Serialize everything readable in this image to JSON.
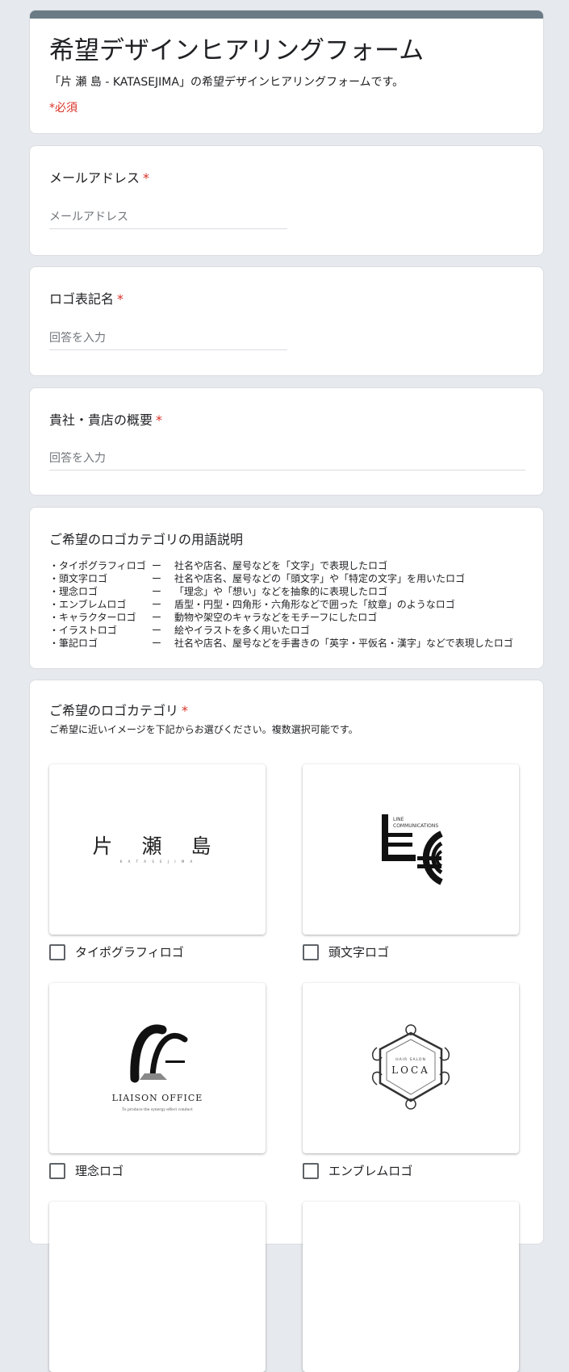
{
  "header": {
    "title": "希望デザインヒアリングフォーム",
    "description": "「片 瀬 島 - KATASEJIMA」の希望デザインヒアリングフォームです。",
    "required_note": "*必須",
    "accent_color": "#6a7b86"
  },
  "questions": {
    "email": {
      "title": "メールアドレス",
      "required_mark": "*",
      "placeholder": "メールアドレス"
    },
    "logo_name": {
      "title": "ロゴ表記名",
      "required_mark": "*",
      "placeholder": "回答を入力"
    },
    "overview": {
      "title": "貴社・貴店の概要",
      "required_mark": "*",
      "placeholder": "回答を入力"
    }
  },
  "glossary": {
    "title": "ご希望のロゴカテゴリの用語説明",
    "items": [
      {
        "term": "・タイポグラフィロゴ",
        "dash": "ー",
        "desc": "社名や店名、屋号などを「文字」で表現したロゴ"
      },
      {
        "term": "・頭文字ロゴ",
        "dash": "ー",
        "desc": "社名や店名、屋号などの「頭文字」や「特定の文字」を用いたロゴ"
      },
      {
        "term": "・理念ロゴ",
        "dash": "ー",
        "desc": "「理念」や「想い」などを抽象的に表現したロゴ"
      },
      {
        "term": "・エンブレムロゴ",
        "dash": "ー",
        "desc": "盾型・円型・四角形・六角形などで囲った「紋章」のようなロゴ"
      },
      {
        "term": "・キャラクターロゴ",
        "dash": "ー",
        "desc": "動物や架空のキャラなどをモチーフにしたロゴ"
      },
      {
        "term": "・イラストロゴ",
        "dash": "ー",
        "desc": "絵やイラストを多く用いたロゴ"
      },
      {
        "term": "・筆記ロゴ",
        "dash": "ー",
        "desc": "社名や店名、屋号などを手書きの「英字・平仮名・漢字」などで表現したロゴ"
      }
    ]
  },
  "category": {
    "title": "ご希望のロゴカテゴリ",
    "required_mark": "*",
    "help": "ご希望に近いイメージを下記からお選びください。複数選択可能です。",
    "options": [
      {
        "label": "タイポグラフィロゴ"
      },
      {
        "label": "頭文字ロゴ"
      },
      {
        "label": "理念ロゴ"
      },
      {
        "label": "エンブレムロゴ"
      }
    ],
    "sample_images": {
      "typography": {
        "logo_text": "片 瀬 島",
        "sub_text": "K A T A S E J I M A"
      },
      "initial": {
        "logo_text": "LINE",
        "sub_text": "COMMUNICATIONS"
      },
      "concept": {
        "logo_text": "LIAISON OFFICE",
        "sub_text": "To produce the synergy effect conduct"
      },
      "emblem": {
        "logo_text": "LOCA",
        "sub_text": "HAIR SALON"
      }
    }
  }
}
